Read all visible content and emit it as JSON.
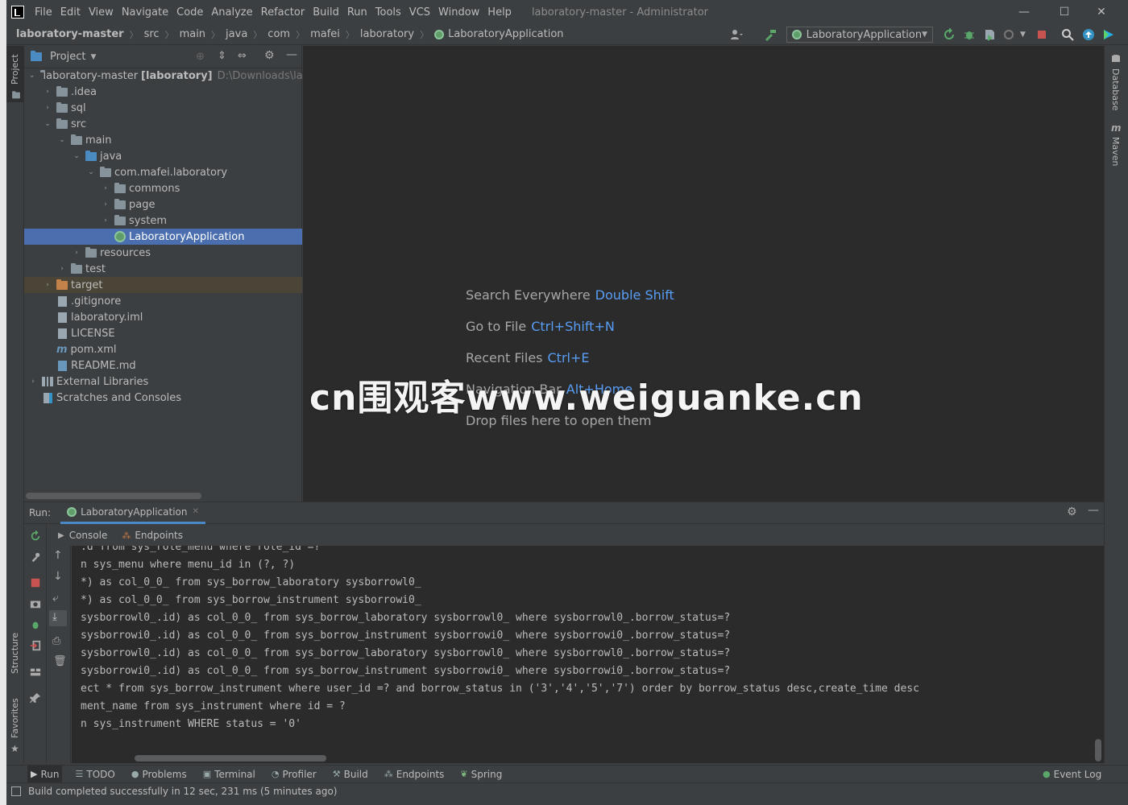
{
  "titlebar": {
    "menu": [
      "File",
      "Edit",
      "View",
      "Navigate",
      "Code",
      "Analyze",
      "Refactor",
      "Build",
      "Run",
      "Tools",
      "VCS",
      "Window",
      "Help"
    ],
    "title": "laboratory-master - Administrator",
    "minimize": "—",
    "maximize": "☐",
    "close": "✕"
  },
  "navbar": {
    "crumbs": [
      "laboratory-master",
      "src",
      "main",
      "java",
      "com",
      "mafei",
      "laboratory",
      "LaboratoryApplication"
    ],
    "run_config": "LaboratoryApplication"
  },
  "left_stripe": {
    "project": "Project",
    "structure": "Structure",
    "favorites": "Favorites"
  },
  "right_stripe": {
    "database": "Database",
    "maven": "Maven"
  },
  "project": {
    "header": "Project",
    "tree": [
      {
        "label": "laboratory-master",
        "extra": "[laboratory]",
        "hint": "D:\\Downloads\\labo"
      },
      {
        "label": ".idea"
      },
      {
        "label": "sql"
      },
      {
        "label": "src"
      },
      {
        "label": "main"
      },
      {
        "label": "java"
      },
      {
        "label": "com.mafei.laboratory"
      },
      {
        "label": "commons"
      },
      {
        "label": "page"
      },
      {
        "label": "system"
      },
      {
        "label": "LaboratoryApplication"
      },
      {
        "label": "resources"
      },
      {
        "label": "test"
      },
      {
        "label": "target"
      },
      {
        "label": ".gitignore"
      },
      {
        "label": "laboratory.iml"
      },
      {
        "label": "LICENSE"
      },
      {
        "label": "pom.xml"
      },
      {
        "label": "README.md"
      },
      {
        "label": "External Libraries"
      },
      {
        "label": "Scratches and Consoles"
      }
    ]
  },
  "editor": {
    "tips": [
      {
        "label": "Search Everywhere",
        "key": "Double Shift"
      },
      {
        "label": "Go to File",
        "key": "Ctrl+Shift+N"
      },
      {
        "label": "Recent Files",
        "key": "Ctrl+E"
      },
      {
        "label": "Navigation Bar",
        "key": "Alt+Home"
      },
      {
        "label": "Drop files here to open them",
        "key": ""
      }
    ]
  },
  "watermark": "cn围观客www.weiguanke.cn",
  "run": {
    "label": "Run:",
    "tab": "LaboratoryApplication",
    "subtabs": [
      "Console",
      "Endpoints"
    ],
    "console_lines": [
      ".d from sys_role_menu where role_id =?",
      "n sys_menu where menu_id in (?, ?)",
      "*) as col_0_0_ from sys_borrow_laboratory sysborrowl0_",
      "*) as col_0_0_ from sys_borrow_instrument sysborrowi0_",
      "sysborrowl0_.id) as col_0_0_ from sys_borrow_laboratory sysborrowl0_ where sysborrowl0_.borrow_status=?",
      "sysborrowi0_.id) as col_0_0_ from sys_borrow_instrument sysborrowi0_ where sysborrowi0_.borrow_status=?",
      "sysborrowl0_.id) as col_0_0_ from sys_borrow_laboratory sysborrowl0_ where sysborrowl0_.borrow_status=?",
      "sysborrowi0_.id) as col_0_0_ from sys_borrow_instrument sysborrowi0_ where sysborrowi0_.borrow_status=?",
      "ect * from sys_borrow_instrument where user_id =? and borrow_status in ('3','4','5','7') order by borrow_status desc,create_time desc",
      "ment_name from sys_instrument where id = ?",
      "n sys_instrument WHERE status = '0'"
    ]
  },
  "bottom_tabs": [
    "Run",
    "TODO",
    "Problems",
    "Terminal",
    "Profiler",
    "Build",
    "Endpoints",
    "Spring"
  ],
  "event_log": "Event Log",
  "status": "Build completed successfully in 12 sec, 231 ms (5 minutes ago)"
}
